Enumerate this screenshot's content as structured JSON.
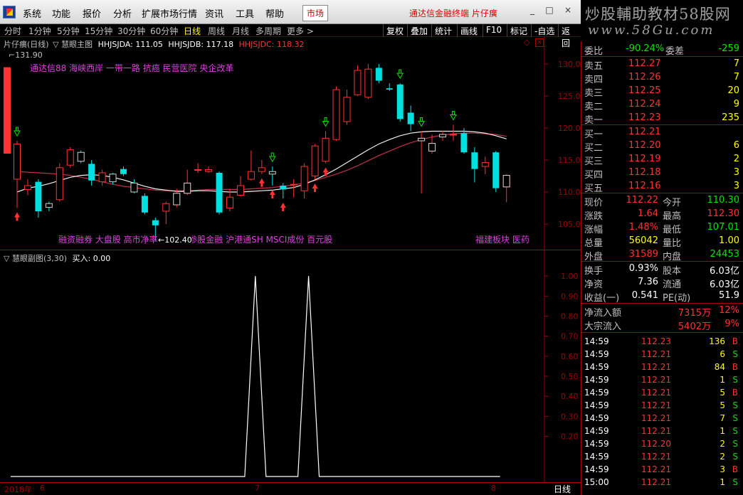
{
  "menubar": {
    "items": [
      "系统",
      "功能",
      "报价",
      "分析",
      "扩展市场行情",
      "资讯",
      "工具",
      "帮助"
    ],
    "market_tab": "市场",
    "app_title": "通达信金融终端 片仔癀",
    "win_min": "_",
    "win_max": "□",
    "win_close": "×"
  },
  "brand": {
    "line1": "炒股輔助教材58股网",
    "line2": "www.58Gu.com"
  },
  "periods": [
    "分时",
    "1分钟",
    "5分钟",
    "15分钟",
    "30分钟",
    "60分钟",
    "日线",
    "周线",
    "月线",
    "多周期",
    "更多 >"
  ],
  "active_period": "日线",
  "toolbar": [
    "复权",
    "叠加",
    "统计",
    "画线",
    "F10",
    "标记",
    "-自选",
    "返回"
  ],
  "main_chart": {
    "header_stock": "片仔癀(日线)",
    "header_indicator": "慧眼主图",
    "hhjsjda": "HHJSJDA: 111.05",
    "hhjsjdb": "HHJSJDB: 117.18",
    "hhjsjdc": "HHJSJDC: 118.32",
    "top_price_label": "131.90",
    "low_price_label": "102.40",
    "concepts_top": "通达信88 海峡西岸 一带一路 抗癌 民营医院 央企改革",
    "concepts_bottom": "融资融券 大盘股 高市净率 三季报 参股金融 沪港通SH MSCI成份 百元股",
    "concepts_right": "福建板块 医药",
    "y_ticks": [
      "130.0",
      "125.0",
      "120.0",
      "115.0",
      "110.0",
      "105.0"
    ]
  },
  "sub_chart": {
    "header": "慧眼副图(3,30)",
    "buy_label": "买入: 0.00",
    "y_ticks": [
      "1.00",
      "0.90",
      "0.80",
      "0.70",
      "0.60",
      "0.50",
      "0.40",
      "0.30",
      "0.20"
    ]
  },
  "datebar": {
    "year_label": "2018年",
    "m6": "6",
    "m7": "7",
    "m8": "8",
    "period_label": "日线"
  },
  "quote": {
    "weibi_label": "委比",
    "weibi": "-90.24%",
    "weicha_label": "委差",
    "weicha": "-259",
    "asks": [
      {
        "label": "卖五",
        "price": "112.27",
        "vol": "7"
      },
      {
        "label": "卖四",
        "price": "112.26",
        "vol": "7"
      },
      {
        "label": "卖三",
        "price": "112.25",
        "vol": "20"
      },
      {
        "label": "卖二",
        "price": "112.24",
        "vol": "9"
      },
      {
        "label": "卖一",
        "price": "112.23",
        "vol": "235"
      }
    ],
    "bids": [
      {
        "label": "买一",
        "price": "112.21",
        "vol": ""
      },
      {
        "label": "买二",
        "price": "112.20",
        "vol": "6"
      },
      {
        "label": "买三",
        "price": "112.19",
        "vol": "2"
      },
      {
        "label": "买四",
        "price": "112.18",
        "vol": "3"
      },
      {
        "label": "买五",
        "price": "112.16",
        "vol": "3"
      }
    ],
    "stats": [
      {
        "l1": "现价",
        "v1": "112.22",
        "c1": "red",
        "l2": "今开",
        "v2": "110.30",
        "c2": "green"
      },
      {
        "l1": "涨跌",
        "v1": "1.64",
        "c1": "red",
        "l2": "最高",
        "v2": "112.30",
        "c2": "red"
      },
      {
        "l1": "涨幅",
        "v1": "1.48%",
        "c1": "red",
        "l2": "最低",
        "v2": "107.01",
        "c2": "green"
      },
      {
        "l1": "总量",
        "v1": "56042",
        "c1": "yellow",
        "l2": "量比",
        "v2": "1.00",
        "c2": "yellow"
      },
      {
        "l1": "外盘",
        "v1": "31589",
        "c1": "red",
        "l2": "内盘",
        "v2": "24453",
        "c2": "green"
      }
    ],
    "fin": [
      {
        "l1": "换手",
        "v1": "0.93%",
        "l2": "股本",
        "v2": "6.03亿"
      },
      {
        "l1": "净资",
        "v1": "7.36",
        "l2": "流通",
        "v2": "6.03亿"
      },
      {
        "l1": "收益(一)",
        "v1": "0.541",
        "l2": "PE(动)",
        "v2": "51.9"
      }
    ],
    "flow": [
      {
        "label": "净流入额",
        "value": "7315万",
        "pct": "12%"
      },
      {
        "label": "大宗流入",
        "value": "5402万",
        "pct": "9%"
      }
    ],
    "ticks": [
      {
        "t": "14:59",
        "p": "112.23",
        "v": "136",
        "s": "B"
      },
      {
        "t": "14:59",
        "p": "112.21",
        "v": "6",
        "s": "S"
      },
      {
        "t": "14:59",
        "p": "112.21",
        "v": "84",
        "s": "B"
      },
      {
        "t": "14:59",
        "p": "112.21",
        "v": "1",
        "s": "S"
      },
      {
        "t": "14:59",
        "p": "112.21",
        "v": "5",
        "s": "B"
      },
      {
        "t": "14:59",
        "p": "112.21",
        "v": "5",
        "s": "S"
      },
      {
        "t": "14:59",
        "p": "112.21",
        "v": "7",
        "s": "S"
      },
      {
        "t": "14:59",
        "p": "112.21",
        "v": "1",
        "s": "S"
      },
      {
        "t": "14:59",
        "p": "112.20",
        "v": "2",
        "s": "S"
      },
      {
        "t": "14:59",
        "p": "112.21",
        "v": "2",
        "s": "S"
      },
      {
        "t": "14:59",
        "p": "112.21",
        "v": "3",
        "s": "B"
      },
      {
        "t": "15:00",
        "p": "112.21",
        "v": "1",
        "s": "S"
      }
    ]
  },
  "chart_data": {
    "type": "candlestick",
    "ylim": [
      102,
      132
    ],
    "candles": [
      {
        "o": 112.0,
        "c": 117.5,
        "h": 118,
        "l": 107.5
      },
      {
        "o": 110.4,
        "c": 111.0,
        "h": 112,
        "l": 109.5
      },
      {
        "o": 111.6,
        "c": 107.0,
        "h": 112,
        "l": 106
      },
      {
        "o": 108.2,
        "c": 107.6,
        "h": 108.5,
        "l": 107
      },
      {
        "o": 108.8,
        "c": 113.8,
        "h": 114.5,
        "l": 108.5
      },
      {
        "o": 114.2,
        "c": 116.6,
        "h": 117,
        "l": 113.8
      },
      {
        "o": 116.2,
        "c": 114.8,
        "h": 116.5,
        "l": 114.5
      },
      {
        "o": 114.4,
        "c": 111.8,
        "h": 115,
        "l": 111
      },
      {
        "o": 111.6,
        "c": 113.0,
        "h": 113.5,
        "l": 111
      },
      {
        "o": 112.8,
        "c": 111.6,
        "h": 113,
        "l": 111.2
      },
      {
        "o": 113.6,
        "c": 112.8,
        "h": 114,
        "l": 112.5
      },
      {
        "o": 111.4,
        "c": 110.0,
        "h": 112,
        "l": 109.8
      },
      {
        "o": 109.4,
        "c": 106.8,
        "h": 109.8,
        "l": 106.5
      },
      {
        "o": 105.6,
        "c": 104.8,
        "h": 106,
        "l": 102.4
      },
      {
        "o": 107.0,
        "c": 108.2,
        "h": 108.5,
        "l": 105
      },
      {
        "o": 108.0,
        "c": 109.8,
        "h": 110.5,
        "l": 107.6
      },
      {
        "o": 109.8,
        "c": 111.4,
        "h": 113.5,
        "l": 109.5
      },
      {
        "o": 113.5,
        "c": 113.5,
        "h": 114.5,
        "l": 113
      },
      {
        "o": 113.2,
        "c": 113.5,
        "h": 114,
        "l": 113
      },
      {
        "o": 113.0,
        "c": 106.8,
        "h": 113.2,
        "l": 106.5
      },
      {
        "o": 107.5,
        "c": 109.2,
        "h": 110.5,
        "l": 107.0
      },
      {
        "o": 109.5,
        "c": 111.0,
        "h": 112.5,
        "l": 109.3
      },
      {
        "o": 112.0,
        "c": 113.2,
        "h": 116.5,
        "l": 111.8
      },
      {
        "o": 113.2,
        "c": 113.8,
        "h": 115,
        "l": 112.8
      },
      {
        "o": 113.2,
        "c": 112.8,
        "h": 114,
        "l": 111
      },
      {
        "o": 111.0,
        "c": 110.4,
        "h": 111.4,
        "l": 109
      },
      {
        "o": 111.2,
        "c": 111.2,
        "h": 112,
        "l": 109.2
      },
      {
        "o": 110.2,
        "c": 114.0,
        "h": 114.5,
        "l": 109
      },
      {
        "o": 112.5,
        "c": 117.2,
        "h": 117.5,
        "l": 112
      },
      {
        "o": 114.8,
        "c": 118.4,
        "h": 119.5,
        "l": 114.5
      },
      {
        "o": 118.2,
        "c": 126.0,
        "h": 126.5,
        "l": 118
      },
      {
        "o": 121.0,
        "c": 124.8,
        "h": 126,
        "l": 120.5
      },
      {
        "o": 125.2,
        "c": 129.0,
        "h": 129.8,
        "l": 125
      },
      {
        "o": 124.8,
        "c": 129.2,
        "h": 130,
        "l": 124.5
      },
      {
        "o": 129.4,
        "c": 127.4,
        "h": 130,
        "l": 127
      },
      {
        "o": 126.2,
        "c": 126.0,
        "h": 127,
        "l": 125.8
      },
      {
        "o": 126.8,
        "c": 121.4,
        "h": 127,
        "l": 121
      },
      {
        "o": 122.4,
        "c": 120.6,
        "h": 123.5,
        "l": 119.5
      },
      {
        "o": 118.0,
        "c": 118.4,
        "h": 119.5,
        "l": 109.8
      },
      {
        "o": 116.4,
        "c": 117.6,
        "h": 119,
        "l": 116
      },
      {
        "o": 118.6,
        "c": 119.0,
        "h": 119.6,
        "l": 118
      },
      {
        "o": 119.0,
        "c": 119.0,
        "h": 120.5,
        "l": 118
      },
      {
        "o": 119.2,
        "c": 116.2,
        "h": 120,
        "l": 116
      },
      {
        "o": 116.2,
        "c": 113.6,
        "h": 117,
        "l": 111.5
      },
      {
        "o": 114.0,
        "c": 114.6,
        "h": 115.5,
        "l": 112.8
      },
      {
        "o": 116.2,
        "c": 110.6,
        "h": 116.4,
        "l": 110
      },
      {
        "o": 110.8,
        "c": 112.6,
        "h": 112.8,
        "l": 108.4
      }
    ],
    "ma_white": [
      110.0,
      110.6,
      110.9,
      111.3,
      111.8,
      112.3,
      112.6,
      112.7,
      112.6,
      112.3,
      111.9,
      111.4,
      110.9,
      110.5,
      110.3,
      110.1,
      110.1,
      110.2,
      110.2,
      110.1,
      110.0,
      110.0,
      110.1,
      110.2,
      110.3,
      110.5,
      110.7,
      111.2,
      111.9,
      112.7,
      113.6,
      114.6,
      115.6,
      116.6,
      117.5,
      118.2,
      118.8,
      119.2,
      119.4,
      119.5,
      119.5,
      119.5,
      119.5,
      119.4,
      119.2,
      118.8,
      118.3
    ],
    "ma_red": [
      113.2,
      113.1,
      113.0,
      112.9,
      112.8,
      112.6,
      112.3,
      112.0,
      111.6,
      111.2,
      110.9,
      110.7,
      110.5,
      110.3,
      110.2,
      110.2,
      110.2,
      110.3,
      110.4,
      110.4,
      110.4,
      110.4,
      110.5,
      110.6,
      110.7,
      110.9,
      111.1,
      111.4,
      111.8,
      112.3,
      112.8,
      113.4,
      114.1,
      114.9,
      115.7,
      116.4,
      117.1,
      117.7,
      118.2,
      118.6,
      118.9,
      119.1,
      119.2,
      119.2,
      119.1,
      119.0,
      118.7
    ],
    "buy_signal": [
      0,
      0,
      0,
      0,
      0,
      0,
      0,
      0,
      0,
      0,
      0,
      0,
      0,
      0,
      0,
      0,
      0,
      0,
      0,
      0,
      0,
      0,
      0,
      1,
      0,
      0,
      0,
      0,
      1,
      0,
      0,
      0,
      0,
      0,
      0,
      0,
      0,
      0,
      0,
      0,
      0,
      0,
      0,
      0,
      0,
      0,
      0
    ],
    "sub_ylim": [
      0,
      1.05
    ]
  }
}
